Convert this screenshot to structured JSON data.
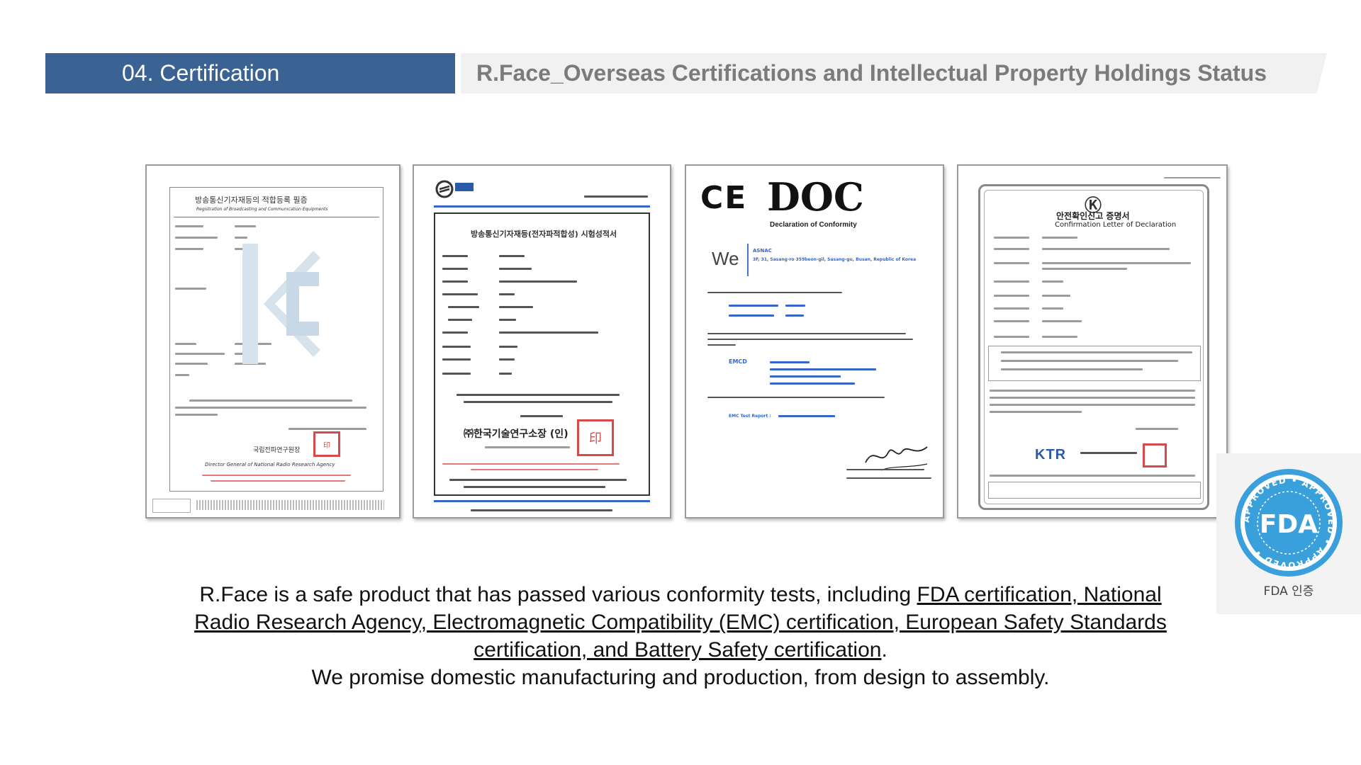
{
  "header": {
    "section_label": "04. Certification",
    "page_title": "R.Face_Overseas Certifications and Intellectual Property Holdings Status"
  },
  "certificates": [
    {
      "title_ko": "방송통신기자재등의 적합등록 필증",
      "title_en": "Registration of Broadcasting and Communication Equipments",
      "issuer": "국립전파연구원장",
      "issuer_en": "Director General of National Radio Research Agency"
    },
    {
      "title_ko": "방송통신기자재등(전자파적합성) 시험성적서",
      "logo": "KTI",
      "issuer": "㈜한국기술연구소장 (인)"
    },
    {
      "mark": "CE",
      "title": "DOC",
      "subtitle": "Declaration of Conformity",
      "we": "We",
      "company": "ASNAC",
      "address": "3F, 31, Sasang-ro 359beon-gil, Sasang-gu, Busan, Republic of Korea",
      "emcd": "EMCD",
      "emc_report": "EMC Test Report :"
    },
    {
      "title_ko": "안전확인신고 증명서",
      "title_en": "Confirmation Letter of Declaration",
      "issuer": "KTR"
    }
  ],
  "fda_badge": {
    "center_text": "FDA",
    "ring_text": "APPROVED • APPROVED • APPROVED •",
    "label": "FDA 인증",
    "color": "#3aa0dc"
  },
  "body": {
    "lead": "R.Face is a safe product that has passed various conformity tests, including ",
    "link": "FDA certification, National Radio Research Agency, Electromagnetic Compatibility (EMC) certification, European Safety Standards certification, and Battery Safety certification",
    "tail": ".",
    "line2": "We promise domestic manufacturing and production, from design to assembly."
  }
}
